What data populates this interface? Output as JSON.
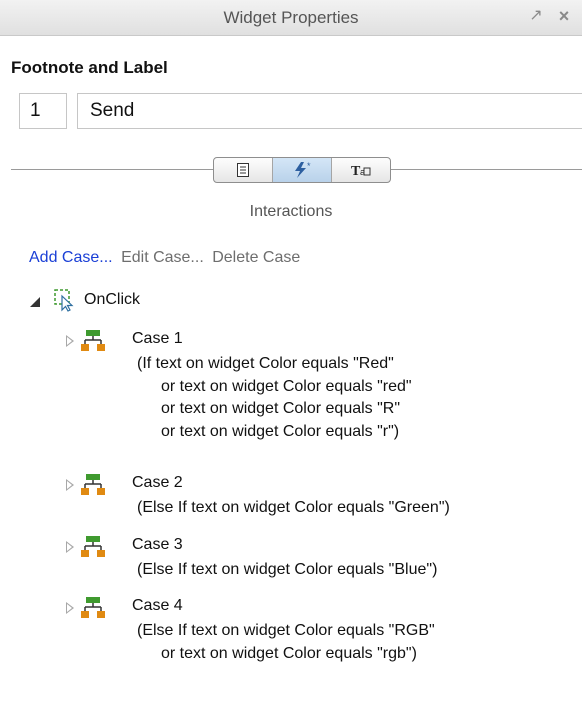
{
  "panel": {
    "title": "Widget Properties",
    "pin_icon": "pin-icon",
    "close_icon": "close-icon"
  },
  "footnote_label": {
    "heading": "Footnote and Label",
    "footnote_value": "1",
    "label_value": "Send"
  },
  "tabs": [
    {
      "icon": "properties-icon",
      "active": false
    },
    {
      "icon": "interactions-lightning-icon",
      "active": true
    },
    {
      "icon": "style-text-icon",
      "active": false
    }
  ],
  "interactions_label": "Interactions",
  "actions": {
    "add_case": "Add Case...",
    "edit_case": "Edit Case...",
    "delete_case": "Delete Case"
  },
  "event": {
    "name": "OnClick",
    "icon": "cursor-event-icon",
    "cases": [
      {
        "name": "Case 1",
        "conditions": [
          "(If text on widget Color equals \"Red\"",
          "or text on widget Color equals \"red\"",
          "or text on widget Color equals \"R\"",
          "or text on widget Color equals \"r\")"
        ]
      },
      {
        "name": "Case 2",
        "conditions": [
          "(Else If text on widget Color equals \"Green\")"
        ]
      },
      {
        "name": "Case 3",
        "conditions": [
          "(Else If text on widget Color equals \"Blue\")"
        ]
      },
      {
        "name": "Case 4",
        "conditions": [
          "(Else If text on widget Color equals \"RGB\"",
          "or text on widget Color equals \"rgb\")"
        ]
      }
    ]
  },
  "colors": {
    "link": "#1a3fd6",
    "disabled_link": "#6e6e6e",
    "case_icon_green": "#3f9a2f",
    "case_icon_orange": "#e08a12"
  }
}
